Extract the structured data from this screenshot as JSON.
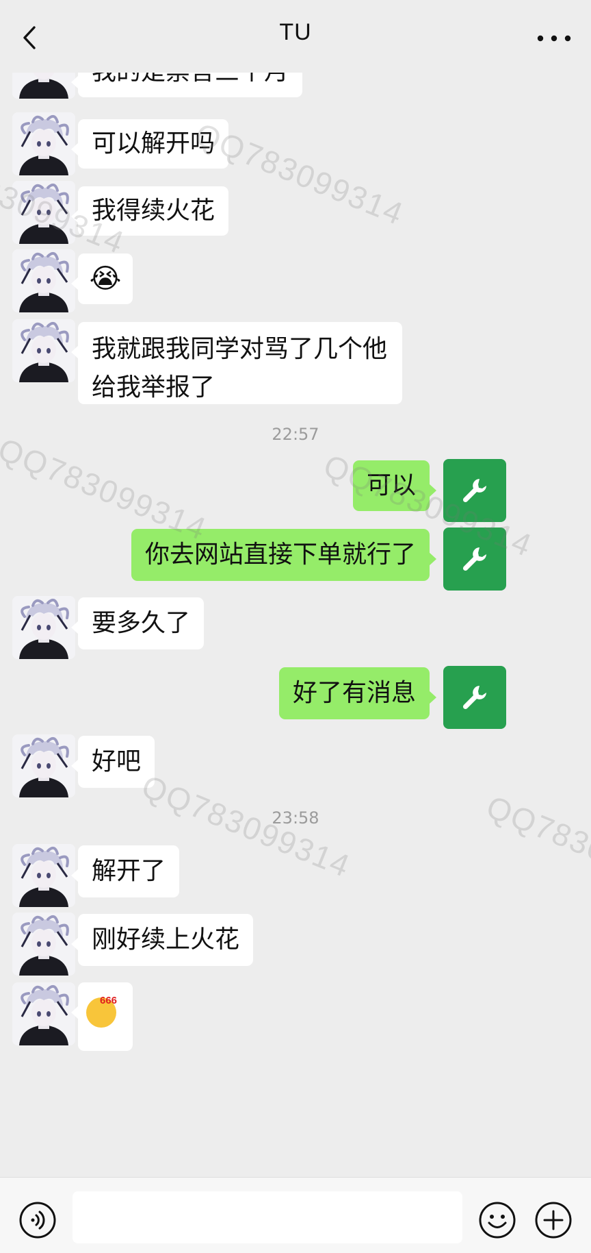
{
  "header": {
    "title": "TU"
  },
  "messages": [
    {
      "side": "left",
      "text": "我的是禁言三个月"
    },
    {
      "side": "left",
      "text": "可以解开吗"
    },
    {
      "side": "left",
      "text": "我得续火花"
    },
    {
      "side": "left",
      "emoji": "😭"
    },
    {
      "side": "left",
      "text": "我就跟我同学对骂了几个他给我举报了"
    },
    {
      "side": "right",
      "text": "可以"
    },
    {
      "side": "right",
      "text": "你去网站直接下单就行了"
    },
    {
      "side": "left",
      "text": "要多久了"
    },
    {
      "side": "right",
      "text": "好了有消息"
    },
    {
      "side": "left",
      "text": "好吧"
    },
    {
      "side": "left",
      "text": "解开了"
    },
    {
      "side": "left",
      "text": "刚好续上火花"
    },
    {
      "side": "left",
      "sticker_text": "666"
    }
  ],
  "timestamps": [
    "22:57",
    "23:58"
  ],
  "watermark": "QQ783099314",
  "colors": {
    "background": "#ededed",
    "bubble_left": "#ffffff",
    "bubble_right": "#95ec69",
    "self_avatar": "#27a04f"
  },
  "icons": {
    "back": "chevron-left-icon",
    "more": "more-dots-icon",
    "self_avatar": "wrench-icon",
    "voice": "voice-icon",
    "emoji": "smiley-icon",
    "plus": "plus-icon"
  }
}
